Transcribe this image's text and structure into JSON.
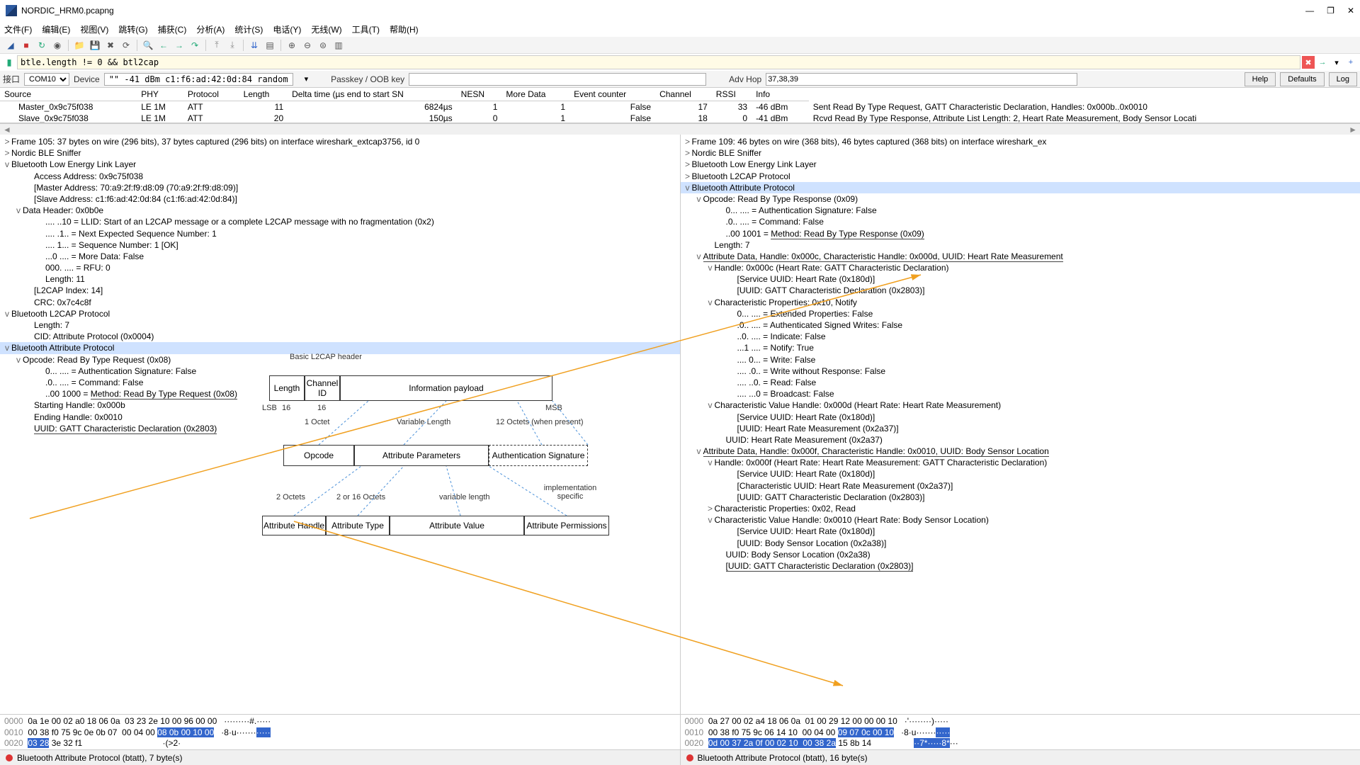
{
  "title": "NORDIC_HRM0.pcapng",
  "menu": [
    "文件(F)",
    "编辑(E)",
    "视图(V)",
    "跳转(G)",
    "捕获(C)",
    "分析(A)",
    "统计(S)",
    "电话(Y)",
    "无线(W)",
    "工具(T)",
    "帮助(H)"
  ],
  "filter": "btle.length != 0 && btl2cap",
  "cfg": {
    "iface_lbl": "接口",
    "iface": "COM10",
    "dev_lbl": "Device",
    "dev_info": "\"\" -41 dBm  c1:f6:ad:42:0d:84  random",
    "passkey_lbl": "Passkey / OOB key",
    "advhop_lbl": "Adv Hop",
    "advhop": "37,38,39",
    "help": "Help",
    "defaults": "Defaults",
    "log": "Log"
  },
  "cols": [
    "Source",
    "PHY",
    "Protocol",
    "Length",
    "Delta time (µs end to start SN",
    "NESN",
    "More Data",
    "Event counter",
    "Channel",
    "RSSI",
    "Info"
  ],
  "rows": [
    [
      "Master_0x9c75f038",
      "LE 1M",
      "ATT",
      "11",
      "6824µs",
      "1",
      "1",
      "False",
      "17",
      "33",
      "-46 dBm",
      "Sent Read By Type Request, GATT Characteristic Declaration, Handles: 0x000b..0x0010"
    ],
    [
      "Slave_0x9c75f038",
      "LE 1M",
      "ATT",
      "20",
      "150µs",
      "0",
      "1",
      "False",
      "18",
      "0",
      "-41 dBm",
      "Rcvd Read By Type Response, Attribute List Length: 2, Heart Rate Measurement, Body Sensor Locati"
    ]
  ],
  "left_tree": [
    {
      "i": 0,
      "t": ">",
      "x": "Frame 105: 37 bytes on wire (296 bits), 37 bytes captured (296 bits) on interface wireshark_extcap3756, id 0"
    },
    {
      "i": 0,
      "t": ">",
      "x": "Nordic BLE Sniffer"
    },
    {
      "i": 0,
      "t": "v",
      "x": "Bluetooth Low Energy Link Layer"
    },
    {
      "i": 2,
      "t": "",
      "x": "Access Address: 0x9c75f038"
    },
    {
      "i": 2,
      "t": "",
      "x": "[Master Address: 70:a9:2f:f9:d8:09 (70:a9:2f:f9:d8:09)]"
    },
    {
      "i": 2,
      "t": "",
      "x": "[Slave Address: c1:f6:ad:42:0d:84 (c1:f6:ad:42:0d:84)]"
    },
    {
      "i": 1,
      "t": "v",
      "x": "Data Header: 0x0b0e"
    },
    {
      "i": 3,
      "t": "",
      "x": ".... ..10 = LLID: Start of an L2CAP message or a complete L2CAP message with no fragmentation (0x2)"
    },
    {
      "i": 3,
      "t": "",
      "x": ".... .1.. = Next Expected Sequence Number: 1"
    },
    {
      "i": 3,
      "t": "",
      "x": ".... 1... = Sequence Number: 1 [OK]"
    },
    {
      "i": 3,
      "t": "",
      "x": "...0 .... = More Data: False"
    },
    {
      "i": 3,
      "t": "",
      "x": "000. .... = RFU: 0"
    },
    {
      "i": 3,
      "t": "",
      "x": "Length: 11"
    },
    {
      "i": 2,
      "t": "",
      "x": "[L2CAP Index: 14]"
    },
    {
      "i": 2,
      "t": "",
      "x": "CRC: 0x7c4c8f"
    },
    {
      "i": 0,
      "t": "v",
      "x": "Bluetooth L2CAP Protocol"
    },
    {
      "i": 2,
      "t": "",
      "x": "Length: 7"
    },
    {
      "i": 2,
      "t": "",
      "x": "CID: Attribute Protocol (0x0004)"
    },
    {
      "i": 0,
      "t": "v",
      "x": "Bluetooth Attribute Protocol",
      "hl": true
    },
    {
      "i": 1,
      "t": "v",
      "x": "Opcode: Read By Type Request (0x08)"
    },
    {
      "i": 3,
      "t": "",
      "x": "0... .... = Authentication Signature: False"
    },
    {
      "i": 3,
      "t": "",
      "x": ".0.. .... = Command: False"
    },
    {
      "i": 3,
      "t": "",
      "x": "..00 1000 = ",
      "u": "Method: Read By Type Request (0x08)"
    },
    {
      "i": 2,
      "t": "",
      "x": "Starting Handle: 0x000b"
    },
    {
      "i": 2,
      "t": "",
      "x": "Ending Handle: 0x0010"
    },
    {
      "i": 2,
      "t": "",
      "u": "UUID: GATT Characteristic Declaration (0x2803)"
    }
  ],
  "right_tree": [
    {
      "i": 0,
      "t": ">",
      "x": "Frame 109: 46 bytes on wire (368 bits), 46 bytes captured (368 bits) on interface wireshark_ex"
    },
    {
      "i": 0,
      "t": ">",
      "x": "Nordic BLE Sniffer"
    },
    {
      "i": 0,
      "t": ">",
      "x": "Bluetooth Low Energy Link Layer"
    },
    {
      "i": 0,
      "t": ">",
      "x": "Bluetooth L2CAP Protocol"
    },
    {
      "i": 0,
      "t": "v",
      "x": "Bluetooth Attribute Protocol",
      "hl": true
    },
    {
      "i": 1,
      "t": "v",
      "x": "Opcode: Read By Type Response (0x09)"
    },
    {
      "i": 3,
      "t": "",
      "x": "0... .... = Authentication Signature: False"
    },
    {
      "i": 3,
      "t": "",
      "x": ".0.. .... = Command: False"
    },
    {
      "i": 3,
      "t": "",
      "x": "..00 1001 = ",
      "u": "Method: Read By Type Response (0x09)"
    },
    {
      "i": 2,
      "t": "",
      "x": "Length: 7"
    },
    {
      "i": 1,
      "t": "v",
      "u": "Attribute Data, Handle: 0x000c, Characteristic Handle: 0x000d, UUID: Heart Rate Measurement"
    },
    {
      "i": 2,
      "t": "v",
      "x": "Handle: 0x000c (Heart Rate: GATT Characteristic Declaration)"
    },
    {
      "i": 4,
      "t": "",
      "x": "[Service UUID: Heart Rate (0x180d)]"
    },
    {
      "i": 4,
      "t": "",
      "x": "[UUID: GATT Characteristic Declaration (0x2803)]"
    },
    {
      "i": 2,
      "t": "v",
      "x": "Characteristic Properties: 0x10, Notify"
    },
    {
      "i": 4,
      "t": "",
      "x": "0... .... = Extended Properties: False"
    },
    {
      "i": 4,
      "t": "",
      "x": ".0.. .... = Authenticated Signed Writes: False"
    },
    {
      "i": 4,
      "t": "",
      "x": "..0. .... = Indicate: False"
    },
    {
      "i": 4,
      "t": "",
      "x": "...1 .... = Notify: True"
    },
    {
      "i": 4,
      "t": "",
      "x": ".... 0... = Write: False"
    },
    {
      "i": 4,
      "t": "",
      "x": ".... .0.. = Write without Response: False"
    },
    {
      "i": 4,
      "t": "",
      "x": ".... ..0. = Read: False"
    },
    {
      "i": 4,
      "t": "",
      "x": ".... ...0 = Broadcast: False"
    },
    {
      "i": 2,
      "t": "v",
      "x": "Characteristic Value Handle: 0x000d (Heart Rate: Heart Rate Measurement)"
    },
    {
      "i": 4,
      "t": "",
      "x": "[Service UUID: Heart Rate (0x180d)]"
    },
    {
      "i": 4,
      "t": "",
      "x": "[UUID: Heart Rate Measurement (0x2a37)]"
    },
    {
      "i": 3,
      "t": "",
      "x": "UUID: Heart Rate Measurement (0x2a37)"
    },
    {
      "i": 1,
      "t": "v",
      "u": "Attribute Data, Handle: 0x000f, Characteristic Handle: 0x0010, UUID: Body Sensor Location"
    },
    {
      "i": 2,
      "t": "v",
      "x": "Handle: 0x000f (Heart Rate: Heart Rate Measurement: GATT Characteristic Declaration)"
    },
    {
      "i": 4,
      "t": "",
      "x": "[Service UUID: Heart Rate (0x180d)]"
    },
    {
      "i": 4,
      "t": "",
      "x": "[Characteristic UUID: Heart Rate Measurement (0x2a37)]"
    },
    {
      "i": 4,
      "t": "",
      "x": "[UUID: GATT Characteristic Declaration (0x2803)]"
    },
    {
      "i": 2,
      "t": ">",
      "x": "Characteristic Properties: 0x02, Read"
    },
    {
      "i": 2,
      "t": "v",
      "x": "Characteristic Value Handle: 0x0010 (Heart Rate: Body Sensor Location)"
    },
    {
      "i": 4,
      "t": "",
      "x": "[Service UUID: Heart Rate (0x180d)]"
    },
    {
      "i": 4,
      "t": "",
      "x": "[UUID: Body Sensor Location (0x2a38)]"
    },
    {
      "i": 3,
      "t": "",
      "x": "UUID: Body Sensor Location (0x2a38)"
    },
    {
      "i": 3,
      "t": "",
      "u": "[UUID: GATT Characteristic Declaration (0x2803)]"
    }
  ],
  "diagram": {
    "l2cap_title": "Basic L2CAP\nheader",
    "length": "Length",
    "cid": "Channel\nID",
    "payload": "Information payload",
    "lsb": "LSB",
    "msb": "MSB",
    "b16a": "16",
    "b16b": "16",
    "oct1": "1 Octet",
    "varlen": "Variable Length",
    "oct12": "12 Octets (when present)",
    "opcode": "Opcode",
    "attparams": "Attribute Parameters",
    "authsig": "Authentication Signature",
    "oct2": "2 Octets",
    "oct2_16": "2 or 16 Octets",
    "varlen2": "variable length",
    "impspec": "implementation\nspecific",
    "ah": "Attribute Handle",
    "at": "Attribute Type",
    "av": "Attribute Value",
    "ap": "Attribute Permissions"
  },
  "hex_left": {
    "l0_off": "0000",
    "l0_hex": "0a 1e 00 02 a0 18 06 0a  03 23 2e 10 00 96 00 00",
    "l0_asc": "·········#.·····",
    "l1_off": "0010",
    "l1_hex_a": "00 38 f0 75 9c 0e 0b 07  00 04 00 ",
    "l1_hex_b": "08 0b 00 10 00",
    "l1_asc_a": "·8·u·······",
    "l1_asc_b": "·····",
    "l2_off": "0020",
    "l2_hex_a": "03 28",
    "l2_hex_b": " 3e 32 f1",
    "l2_asc": "·(>2·"
  },
  "hex_right": {
    "l0_off": "0000",
    "l0_hex": "0a 27 00 02 a4 18 06 0a  01 00 29 12 00 00 00 10",
    "l0_asc": "·'········)·····",
    "l1_off": "0010",
    "l1_hex_a": "00 38 f0 75 9c 06 14 10  00 04 00 ",
    "l1_hex_b": "09 07 0c 00 10",
    "l1_asc_a": "·8·u·······",
    "l1_asc_b": "·····",
    "l2_off": "0020",
    "l2_hex_a": "0d 00 37 2a 0f 00 02 10  00 38 2a",
    "l2_hex_b": " 15 8b 14",
    "l2_asc_a": "··7*·····8*",
    "l2_asc_b": "···"
  },
  "status": {
    "left": "Bluetooth Attribute Protocol (btatt), 7 byte(s)",
    "right": "Bluetooth Attribute Protocol (btatt), 16 byte(s)"
  }
}
